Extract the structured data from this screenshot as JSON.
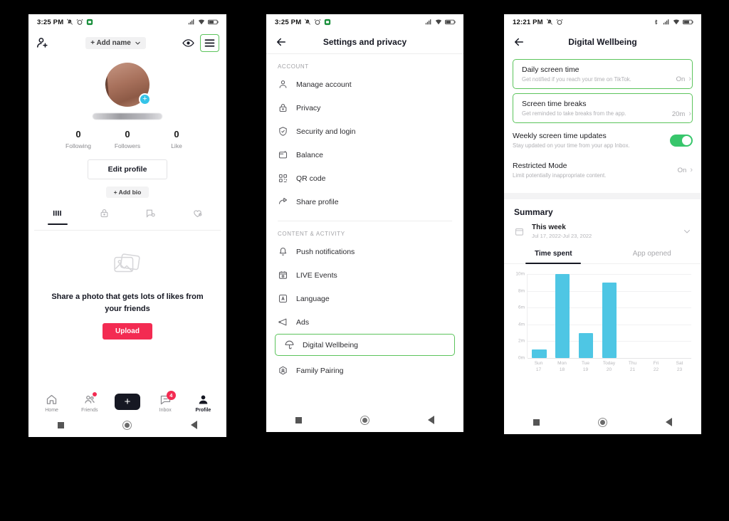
{
  "phone1": {
    "statusbar": {
      "time": "3:25 PM",
      "icons": [
        "mute-icon",
        "alarm-icon",
        "app-icon"
      ],
      "right_icons": [
        "signal-icon",
        "wifi-icon",
        "battery-icon"
      ]
    },
    "topbar": {
      "add_friend_icon": "add-person-icon",
      "add_name_label": "+ Add name",
      "eye_icon": "eye-icon",
      "menu_icon": "hamburger-menu-icon"
    },
    "profile": {
      "avatar": "profile-avatar",
      "add_badge": "+",
      "stats": [
        {
          "num": "0",
          "label": "Following"
        },
        {
          "num": "0",
          "label": "Followers"
        },
        {
          "num": "0",
          "label": "Like"
        }
      ],
      "edit_profile_label": "Edit profile",
      "add_bio_label": "+ Add bio"
    },
    "tabs": [
      {
        "icon": "grid-posts-icon",
        "active": true
      },
      {
        "icon": "lock-private-icon",
        "active": false
      },
      {
        "icon": "repost-icon",
        "active": false
      },
      {
        "icon": "heart-liked-icon",
        "active": false
      }
    ],
    "empty_state": {
      "icon": "photo-stack-icon",
      "text": "Share a photo that gets lots of likes from your friends",
      "upload_label": "Upload"
    },
    "bottomnav": [
      {
        "label": "Home",
        "icon": "home-icon",
        "active": false,
        "dot": false,
        "badge": ""
      },
      {
        "label": "Friends",
        "icon": "friends-icon",
        "active": false,
        "dot": true,
        "badge": ""
      },
      {
        "label": "",
        "icon": "create-plus-icon",
        "active": false,
        "dot": false,
        "badge": ""
      },
      {
        "label": "Inbox",
        "icon": "inbox-icon",
        "active": false,
        "dot": false,
        "badge": "4"
      },
      {
        "label": "Profile",
        "icon": "profile-icon",
        "active": true,
        "dot": false,
        "badge": ""
      }
    ]
  },
  "phone2": {
    "statusbar": {
      "time": "3:25 PM"
    },
    "header": {
      "back_icon": "back-arrow-icon",
      "title": "Settings and privacy"
    },
    "sections": [
      {
        "label": "ACCOUNT",
        "items": [
          {
            "icon": "person-icon",
            "label": "Manage account",
            "highlighted": false
          },
          {
            "icon": "lock-icon",
            "label": "Privacy",
            "highlighted": false
          },
          {
            "icon": "shield-check-icon",
            "label": "Security and login",
            "highlighted": false
          },
          {
            "icon": "wallet-icon",
            "label": "Balance",
            "highlighted": false
          },
          {
            "icon": "qr-code-icon",
            "label": "QR code",
            "highlighted": false
          },
          {
            "icon": "share-arrow-icon",
            "label": "Share profile",
            "highlighted": false
          }
        ]
      },
      {
        "label": "CONTENT & ACTIVITY",
        "items": [
          {
            "icon": "bell-icon",
            "label": "Push notifications",
            "highlighted": false
          },
          {
            "icon": "live-calendar-icon",
            "label": "LIVE Events",
            "highlighted": false
          },
          {
            "icon": "language-icon",
            "label": "Language",
            "highlighted": false
          },
          {
            "icon": "megaphone-ads-icon",
            "label": "Ads",
            "highlighted": false
          },
          {
            "icon": "umbrella-wellbeing-icon",
            "label": "Digital Wellbeing",
            "highlighted": true
          },
          {
            "icon": "family-pairing-icon",
            "label": "Family Pairing",
            "highlighted": false
          }
        ]
      }
    ]
  },
  "phone3": {
    "statusbar": {
      "time": "12:21 PM"
    },
    "header": {
      "back_icon": "back-arrow-icon",
      "title": "Digital Wellbeing"
    },
    "settings": [
      {
        "title": "Daily screen time",
        "subtitle": "Get notified if you reach your time on TikTok.",
        "value": "On",
        "control": "chevron",
        "highlighted": true
      },
      {
        "title": "Screen time breaks",
        "subtitle": "Get reminded to take breaks from the app.",
        "value": "20m",
        "control": "chevron",
        "highlighted": true
      },
      {
        "title": "Weekly screen time updates",
        "subtitle": "Stay updated on your time from your app Inbox.",
        "value": "",
        "control": "toggle-on",
        "highlighted": false
      },
      {
        "title": "Restricted Mode",
        "subtitle": "Limit potentially inappropriate content.",
        "value": "On",
        "control": "chevron",
        "highlighted": false
      }
    ],
    "summary": {
      "title": "Summary",
      "calendar_icon": "calendar-icon",
      "period_name": "This week",
      "period_range": "Jul 17, 2022-Jul 23, 2022",
      "expand_icon": "chevron-down-icon",
      "tabs": [
        {
          "label": "Time spent",
          "active": true
        },
        {
          "label": "App opened",
          "active": false
        }
      ]
    },
    "chart_data": {
      "type": "bar",
      "title": "Time spent",
      "categories": [
        "Sun\n17",
        "Mon\n18",
        "Tue\n19",
        "Today\n20",
        "Thu\n21",
        "Fri\n22",
        "Sat\n23"
      ],
      "category_days": [
        "Sun",
        "Mon",
        "Tue",
        "Today",
        "Thu",
        "Fri",
        "Sat"
      ],
      "category_dates": [
        "17",
        "18",
        "19",
        "20",
        "21",
        "22",
        "23"
      ],
      "values": [
        1,
        10,
        3,
        9,
        0,
        0,
        0
      ],
      "ytick_labels": [
        "0m",
        "2m",
        "4m",
        "6m",
        "8m",
        "10m"
      ],
      "ytick_values": [
        0,
        2,
        4,
        6,
        8,
        10
      ],
      "ylim": [
        0,
        10
      ],
      "xlabel": "",
      "ylabel": "",
      "unit": "m",
      "grid": true,
      "legend": "none",
      "bar_color": "#4ec6e4"
    }
  },
  "colors": {
    "highlight_green": "#5cc45c",
    "bar_cyan": "#4ec6e4",
    "toggle_green": "#37c66b",
    "accent_red": "#f32b52",
    "background": "#000000"
  }
}
